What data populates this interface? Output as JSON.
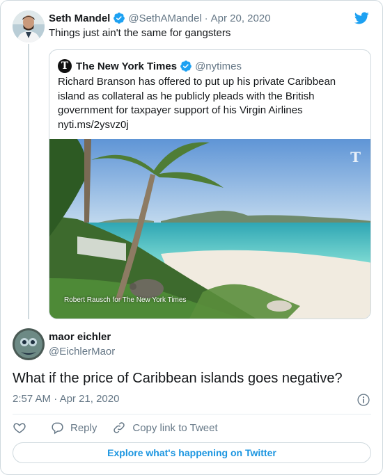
{
  "original_tweet": {
    "author_name": "Seth Mandel",
    "author_handle": "@SethAMandel",
    "separator": "·",
    "date": "Apr 20, 2020",
    "text": "Things just ain't the same for gangsters"
  },
  "quoted_tweet": {
    "author_name": "The New York Times",
    "author_handle": "@nytimes",
    "text": "Richard Branson has offered to put up his private Caribbean island as collateral as he publicly pleads with the British government for taxpayer support of his Virgin Airlines",
    "link": "nyti.ms/2ysvz0j",
    "photo_credit": "Robert Rausch for The New York Times",
    "watermark": "T"
  },
  "reply_tweet": {
    "author_name": "maor eichler",
    "author_handle": "@EichlerMaor",
    "text": "What if the price of Caribbean islands goes negative?",
    "time": "2:57 AM",
    "separator": "·",
    "date": "Apr 21, 2020"
  },
  "actions": {
    "reply_label": "Reply",
    "copy_link_label": "Copy link to Tweet"
  },
  "explore_label": "Explore what's happening on Twitter",
  "colors": {
    "twitter_blue": "#1da1f2",
    "link_blue": "#1b95e0",
    "muted_gray": "#657786",
    "border": "#cfd9de"
  },
  "icons": [
    "twitter-bird-icon",
    "verified-badge-icon",
    "nyt-logo-icon",
    "info-icon",
    "heart-icon",
    "reply-icon",
    "copy-link-icon"
  ]
}
